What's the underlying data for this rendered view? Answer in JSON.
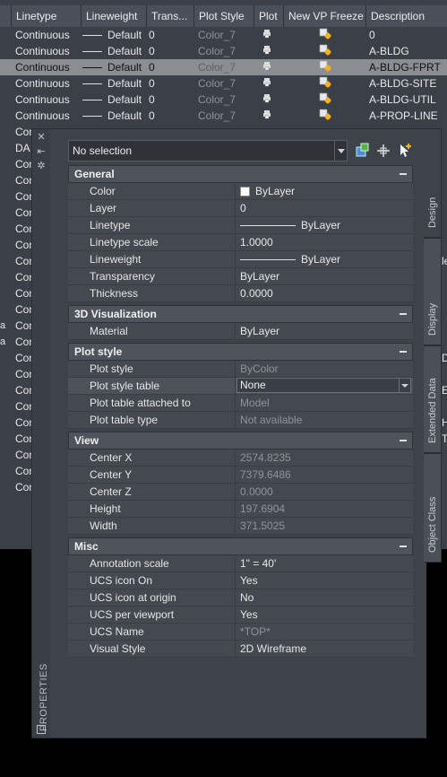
{
  "layer_manager": {
    "columns": [
      "Linetype",
      "Lineweight",
      "Trans...",
      "Plot Style",
      "Plot",
      "New VP Freeze",
      "Description"
    ],
    "rows": [
      {
        "linetype": "Continuous",
        "lineweight": "Default",
        "transparency": "0",
        "plot_style": "Color_7",
        "description": "0",
        "selected": false
      },
      {
        "linetype": "Continuous",
        "lineweight": "Default",
        "transparency": "0",
        "plot_style": "Color_7",
        "description": "A-BLDG",
        "selected": false
      },
      {
        "linetype": "Continuous",
        "lineweight": "Default",
        "transparency": "0",
        "plot_style": "Color_7",
        "description": "A-BLDG-FPRT",
        "selected": true
      },
      {
        "linetype": "Continuous",
        "lineweight": "Default",
        "transparency": "0",
        "plot_style": "Color_7",
        "description": "A-BLDG-SITE",
        "selected": false
      },
      {
        "linetype": "Continuous",
        "lineweight": "Default",
        "transparency": "0",
        "plot_style": "Color_7",
        "description": "A-BLDG-UTIL",
        "selected": false
      },
      {
        "linetype": "Continuous",
        "lineweight": "Default",
        "transparency": "0",
        "plot_style": "Color_7",
        "description": "A-PROP-LINE",
        "selected": false
      }
    ],
    "partial_rows": [
      "Con",
      "DA",
      "Con",
      "Con",
      "Con",
      "Con",
      "Con",
      "Con",
      "Con",
      "Con",
      "Con",
      "Con",
      "Con",
      "Con",
      "Con",
      "Con",
      "Con",
      "Con",
      "Con",
      "Con",
      "Con",
      "Con",
      "Con"
    ],
    "left_fragments": [
      "a",
      "a"
    ],
    "right_fragments": [
      "le",
      "D",
      "E",
      "H",
      "T"
    ]
  },
  "properties": {
    "palette_title": "PROPERTIES",
    "selection": "No selection",
    "tabs": [
      "Design",
      "Display",
      "Extended Data",
      "Object Class"
    ],
    "sections": [
      {
        "title": "General",
        "rows": [
          {
            "key": "Color",
            "value": "ByLayer",
            "kind": "color"
          },
          {
            "key": "Layer",
            "value": "0",
            "kind": "text"
          },
          {
            "key": "Linetype",
            "value": "ByLayer",
            "kind": "line"
          },
          {
            "key": "Linetype scale",
            "value": "1.0000",
            "kind": "text"
          },
          {
            "key": "Lineweight",
            "value": "ByLayer",
            "kind": "line"
          },
          {
            "key": "Transparency",
            "value": "ByLayer",
            "kind": "text"
          },
          {
            "key": "Thickness",
            "value": "0.0000",
            "kind": "text"
          }
        ]
      },
      {
        "title": "3D Visualization",
        "rows": [
          {
            "key": "Material",
            "value": "ByLayer",
            "kind": "text"
          }
        ]
      },
      {
        "title": "Plot style",
        "rows": [
          {
            "key": "Plot style",
            "value": "ByColor",
            "kind": "dim"
          },
          {
            "key": "Plot style table",
            "value": "None",
            "kind": "combo"
          },
          {
            "key": "Plot table attached to",
            "value": "Model",
            "kind": "dim"
          },
          {
            "key": "Plot table type",
            "value": "Not available",
            "kind": "dim"
          }
        ]
      },
      {
        "title": "View",
        "rows": [
          {
            "key": "Center X",
            "value": "2574.8235",
            "kind": "dim"
          },
          {
            "key": "Center Y",
            "value": "7379.6486",
            "kind": "dim"
          },
          {
            "key": "Center Z",
            "value": "0.0000",
            "kind": "dim"
          },
          {
            "key": "Height",
            "value": "197.6904",
            "kind": "dim"
          },
          {
            "key": "Width",
            "value": "371.5025",
            "kind": "dim"
          }
        ]
      },
      {
        "title": "Misc",
        "rows": [
          {
            "key": "Annotation scale",
            "value": "1\" = 40'",
            "kind": "text"
          },
          {
            "key": "UCS icon On",
            "value": "Yes",
            "kind": "text"
          },
          {
            "key": "UCS icon at origin",
            "value": "No",
            "kind": "text"
          },
          {
            "key": "UCS per viewport",
            "value": "Yes",
            "kind": "text"
          },
          {
            "key": "UCS Name",
            "value": "*TOP*",
            "kind": "dim"
          },
          {
            "key": "Visual Style",
            "value": "2D Wireframe",
            "kind": "text"
          }
        ]
      }
    ]
  }
}
